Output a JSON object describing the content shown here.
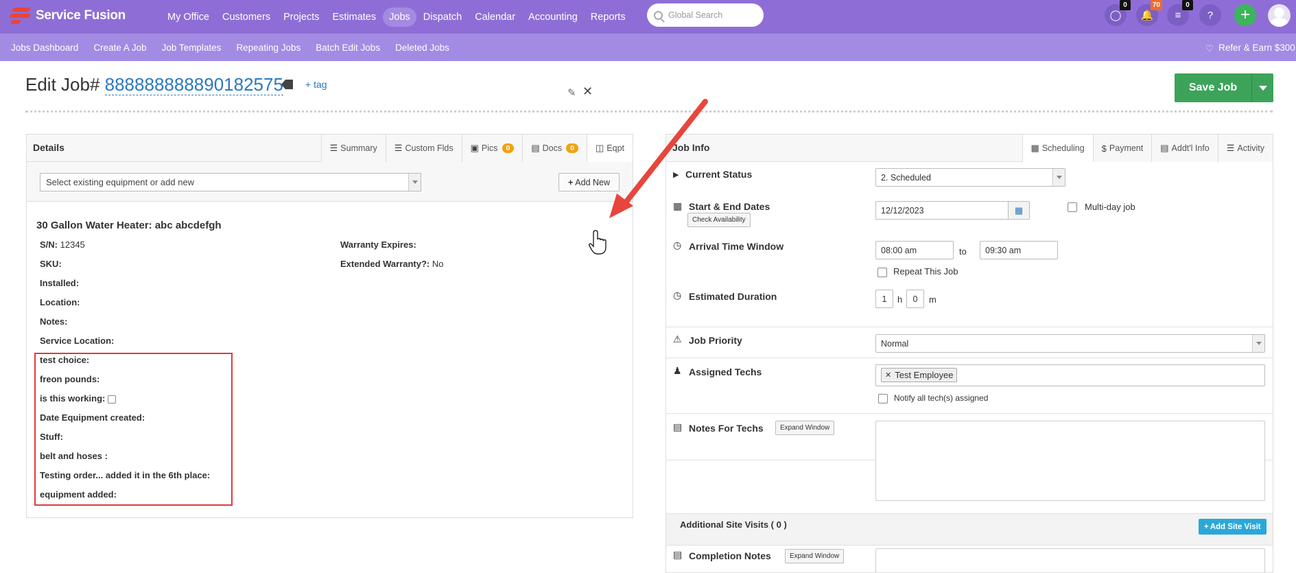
{
  "brand": {
    "name": "Service Fusion"
  },
  "main_nav": [
    {
      "label": "My Office",
      "active": false
    },
    {
      "label": "Customers",
      "active": false
    },
    {
      "label": "Projects",
      "active": false
    },
    {
      "label": "Estimates",
      "active": false
    },
    {
      "label": "Jobs",
      "active": true
    },
    {
      "label": "Dispatch",
      "active": false
    },
    {
      "label": "Calendar",
      "active": false
    },
    {
      "label": "Accounting",
      "active": false
    },
    {
      "label": "Reports",
      "active": false
    }
  ],
  "search": {
    "placeholder": "Global Search"
  },
  "top_icons": {
    "chat_badge": "0",
    "notifications_badge": "70",
    "tasks_badge": "0",
    "help": "?"
  },
  "sub_nav": [
    "Jobs Dashboard",
    "Create A Job",
    "Job Templates",
    "Repeating Jobs",
    "Batch Edit Jobs",
    "Deleted Jobs"
  ],
  "refer": "Refer & Earn $300",
  "page": {
    "title_prefix": "Edit Job#",
    "job_number": "888888888890182575",
    "tag_link": "+ tag",
    "save_label": "Save Job"
  },
  "details": {
    "title": "Details",
    "tabs": [
      {
        "label": "Summary",
        "badge": null
      },
      {
        "label": "Custom Flds",
        "badge": null
      },
      {
        "label": "Pics",
        "badge": "0"
      },
      {
        "label": "Docs",
        "badge": "0"
      },
      {
        "label": "Eqpt",
        "badge": null
      }
    ],
    "equipment_select_placeholder": "Select existing equipment or add new",
    "add_new_label": "Add New",
    "equipment": {
      "title": "30 Gallon Water Heater: abc abcdefgh",
      "sn_label": "S/N:",
      "sn_value": "12345",
      "sku_label": "SKU:",
      "installed_label": "Installed:",
      "location_label": "Location:",
      "notes_label": "Notes:",
      "service_location_label": "Service Location:",
      "warranty_label": "Warranty Expires:",
      "ext_warranty_label": "Extended Warranty?:",
      "ext_warranty_value": "No",
      "custom_fields": [
        "test choice:",
        "freon pounds:",
        "is this working:",
        "Date Equipment created:",
        "Stuff:",
        "belt and hoses :",
        "Testing order... added it in the 6th place:",
        "equipment added:"
      ]
    }
  },
  "job_info": {
    "title": "Job Info",
    "tabs": [
      "Scheduling",
      "Payment",
      "Addt'l Info",
      "Activity"
    ],
    "current_status_label": "Current Status",
    "current_status_value": "2. Scheduled",
    "dates_label": "Start & End Dates",
    "check_availability": "Check Availability",
    "start_date": "12/12/2023",
    "multiday_label": "Multi-day job",
    "arrival_label": "Arrival Time Window",
    "arrival_start": "08:00 am",
    "arrival_to": "to",
    "arrival_end": "09:30 am",
    "repeat_label": "Repeat This Job",
    "duration_label": "Estimated Duration",
    "duration_hours": "1",
    "duration_h": "h",
    "duration_minutes": "0",
    "duration_m": "m",
    "priority_label": "Job Priority",
    "priority_value": "Normal",
    "techs_label": "Assigned Techs",
    "tech_chip": "Test Employee",
    "notify_label": "Notify all tech(s) assigned",
    "notes_label": "Notes For Techs",
    "expand_window": "Expand Window",
    "site_visits_label": "Additional Site Visits ( 0 )",
    "add_site_visit": "Add Site Visit",
    "completion_label": "Completion Notes"
  },
  "colors": {
    "topbar": "#8e6ed6",
    "subbar": "#a28be3",
    "save_green": "#3da35a",
    "badge_orange": "#f3a20e",
    "highlight_red": "#e03a3a",
    "link_blue": "#2b78c1"
  }
}
